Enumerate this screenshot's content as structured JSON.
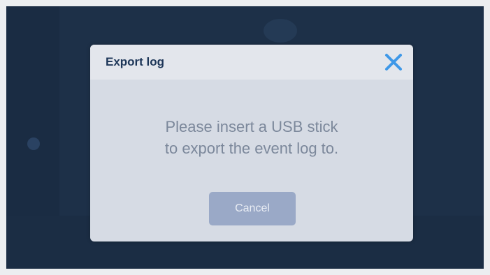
{
  "dialog": {
    "title": "Export log",
    "message_line1": "Please insert a USB stick",
    "message_line2": "to export the event log to.",
    "cancel_label": "Cancel",
    "close_icon": "close-icon"
  },
  "colors": {
    "screen_background": "#1d3048",
    "dialog_background": "#d6dbe4",
    "title_text": "#1d3658",
    "close_icon": "#3e98e8",
    "message_text": "#7c889b",
    "cancel_button": "#9aa9c7"
  }
}
